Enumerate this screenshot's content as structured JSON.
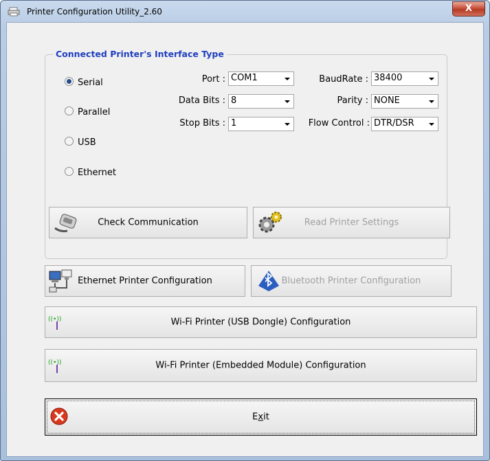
{
  "window": {
    "title": "Printer Configuration Utility_2.60",
    "close_label": "X"
  },
  "interface_group": {
    "title": "Connected Printer's Interface Type",
    "radios": [
      {
        "label": "Serial",
        "selected": true
      },
      {
        "label": "Parallel",
        "selected": false
      },
      {
        "label": "USB",
        "selected": false
      },
      {
        "label": "Ethernet",
        "selected": false
      }
    ],
    "fields": {
      "port": {
        "label": "Port :",
        "value": "COM1"
      },
      "data_bits": {
        "label": "Data Bits :",
        "value": "8"
      },
      "stop_bits": {
        "label": "Stop Bits :",
        "value": "1"
      },
      "baud_rate": {
        "label": "BaudRate :",
        "value": "38400"
      },
      "parity": {
        "label": "Parity :",
        "value": "NONE"
      },
      "flow_control": {
        "label": "Flow Control :",
        "value": "DTR/DSR"
      }
    },
    "check_communication": "Check Communication",
    "read_printer_settings": "Read Printer Settings"
  },
  "buttons": {
    "ethernet_config": "Ethernet Printer Configuration",
    "bluetooth_config": "Bluetooth Printer Configuration",
    "wifi_usb_dongle": "Wi-Fi Printer (USB Dongle) Configuration",
    "wifi_embedded": "Wi-Fi Printer (Embedded Module) Configuration",
    "exit_prefix": "E",
    "exit_mnemonic": "x",
    "exit_suffix": "it"
  },
  "icons": {
    "title": "printer-icon",
    "check_comm": "serial-cable-icon",
    "read_settings": "gears-icon",
    "ethernet": "network-computers-icon",
    "bluetooth": "bluetooth-icon",
    "wifi": "wifi-antenna-icon",
    "exit": "exit-x-icon"
  },
  "colors": {
    "group_title": "#1f3fbf",
    "exit_icon": "#d8391e",
    "bluetooth": "#2a5fc0",
    "wifi": "#1aa11a"
  }
}
